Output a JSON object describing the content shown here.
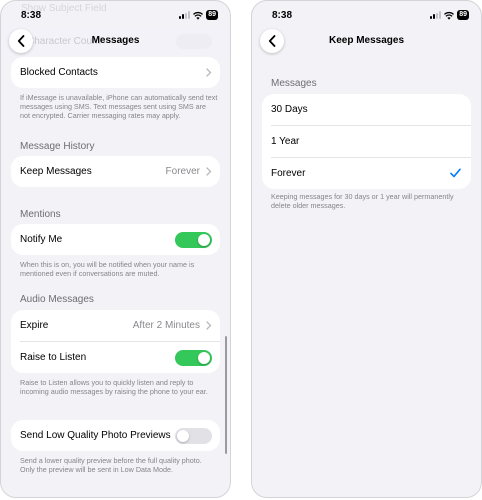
{
  "status_bar": {
    "time": "8:38",
    "battery": "89"
  },
  "left": {
    "nav": {
      "title": "Messages",
      "behind_text": "Character Count"
    },
    "ghost_top": "Show Subject Field",
    "blocked_contacts": {
      "label": "Blocked Contacts"
    },
    "imessage_footer": "If iMessage is unavailable, iPhone can automatically send text messages using SMS. Text messages sent using SMS are not encrypted. Carrier messaging rates may apply.",
    "message_history": {
      "header": "Message History",
      "keep_label": "Keep Messages",
      "keep_value": "Forever"
    },
    "mentions": {
      "header": "Mentions",
      "notify_label": "Notify Me",
      "notify_on": true,
      "footer": "When this is on, you will be notified when your name is mentioned even if conversations are muted."
    },
    "audio": {
      "header": "Audio Messages",
      "expire_label": "Expire",
      "expire_value": "After 2 Minutes",
      "raise_label": "Raise to Listen",
      "raise_on": true,
      "footer": "Raise to Listen allows you to quickly listen and reply to incoming audio messages by raising the phone to your ear."
    },
    "low_quality": {
      "label": "Send Low Quality Photo Previews",
      "on": false,
      "footer": "Send a lower quality preview before the full quality photo. Only the preview will be sent in Low Data Mode."
    }
  },
  "right": {
    "nav": {
      "title": "Keep Messages"
    },
    "section_header": "Messages",
    "options": [
      {
        "label": "30 Days",
        "selected": false
      },
      {
        "label": "1 Year",
        "selected": false
      },
      {
        "label": "Forever",
        "selected": true
      }
    ],
    "footer": "Keeping messages for 30 days or 1 year will permanently delete older messages."
  },
  "colors": {
    "toggle_on": "#34c759",
    "checkmark": "#007aff",
    "background": "#f2f2f7"
  },
  "icons": {
    "back": "chevron-left-icon",
    "disclosure": "chevron-right-icon",
    "selected": "checkmark-icon"
  }
}
